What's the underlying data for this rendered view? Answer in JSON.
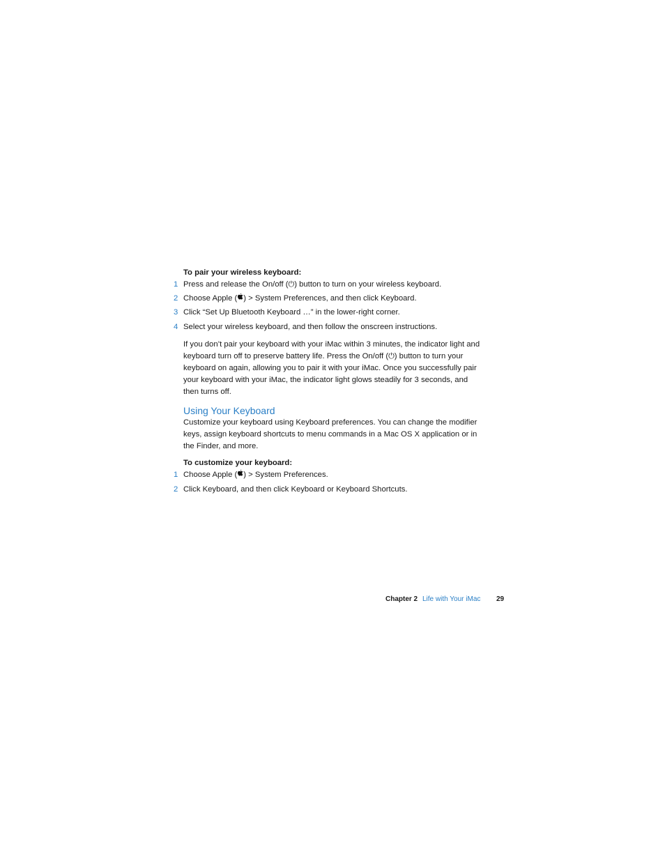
{
  "section1": {
    "title": "To pair your wireless keyboard:",
    "steps": [
      {
        "num": "1",
        "before": "Press and release the On/off (",
        "icon": "power-icon",
        "after": ") button to turn on your wireless keyboard."
      },
      {
        "num": "2",
        "before": "Choose Apple (",
        "icon": "apple-icon",
        "after": ") > System Preferences, and then click Keyboard."
      },
      {
        "num": "3",
        "text": "Click “Set Up Bluetooth Keyboard …” in the lower-right corner."
      },
      {
        "num": "4",
        "text": "Select your wireless keyboard, and then follow the onscreen instructions."
      }
    ],
    "note_lines": [
      "If you don’t pair your keyboard with your iMac within 3 minutes, the indicator light and",
      "keyboard turn off to preserve battery life. Press the On/off (",
      ") button to turn your",
      "keyboard on again, allowing you to pair it with your iMac. Once you successfully pair",
      "your keyboard with your iMac, the indicator light glows steadily for 3 seconds, and",
      "then turns off."
    ]
  },
  "section2": {
    "heading": "Using Your Keyboard",
    "intro_lines": [
      "Customize your keyboard using Keyboard preferences. You can change the modifier",
      "keys, assign keyboard shortcuts to menu commands in a Mac OS X application or in",
      "the Finder, and more."
    ],
    "title": "To customize your keyboard:",
    "steps": [
      {
        "num": "1",
        "before": "Choose Apple (",
        "icon": "apple-icon",
        "after": ") > System Preferences."
      },
      {
        "num": "2",
        "text": "Click Keyboard, and then click Keyboard or Keyboard Shortcuts."
      }
    ]
  },
  "footer": {
    "chapter": "Chapter 2",
    "chapter_title": "Life with Your iMac",
    "page_number": "29"
  },
  "icons": {
    "power": "⏻",
    "apple": ""
  },
  "colors": {
    "accent": "#2a7fc6",
    "text": "#1a1a1a"
  }
}
